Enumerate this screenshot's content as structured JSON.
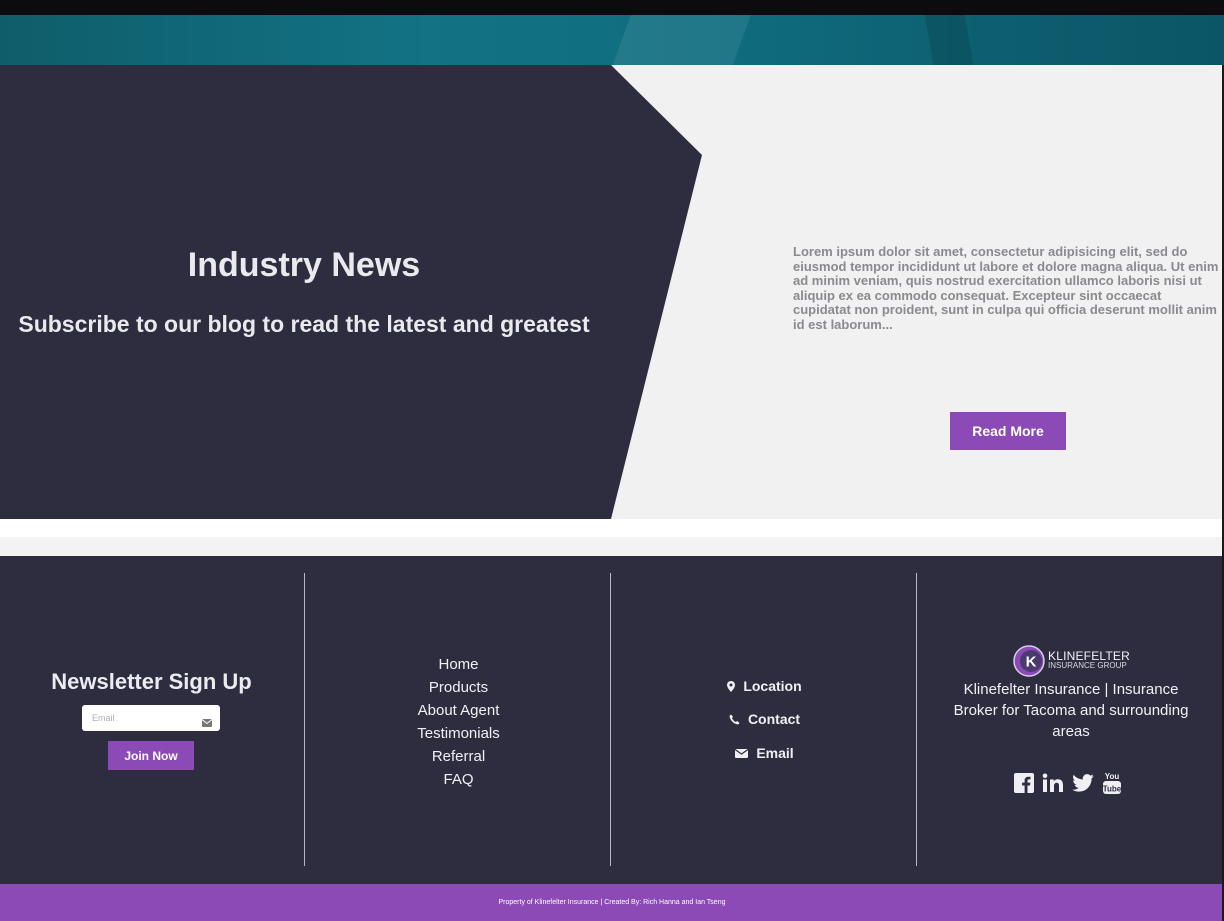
{
  "news": {
    "title": "Industry News",
    "subtitle": "Subscribe to our blog to read the latest and greatest",
    "body": "Lorem ipsum dolor sit amet, consectetur adipisicing elit, sed do eiusmod tempor incididunt ut labore et dolore magna aliqua. Ut enim ad minim veniam, quis nostrud exercitation ullamco laboris nisi ut aliquip ex ea commodo consequat. Excepteur sint occaecat cupidatat non proident, sunt in culpa qui officia deserunt mollit anim id est laborum...",
    "read_more_label": "Read More"
  },
  "newsletter": {
    "title": "Newsletter Sign Up",
    "email_placeholder": "Email",
    "join_label": "Join Now"
  },
  "nav": {
    "items": [
      "Home",
      "Products",
      "About Agent",
      "Testimonials",
      "Referral",
      "FAQ"
    ]
  },
  "contact": {
    "location_label": "Location",
    "contact_label": "Contact",
    "email_label": "Email"
  },
  "brand": {
    "logo_line1": "KLINEFELTER",
    "logo_line2": "INSURANCE GROUP",
    "logo_letter": "K",
    "description": "Klinefelter Insurance | Insurance Broker for Tacoma and surrounding areas"
  },
  "footer": {
    "copyright": "Property of Klinefelter Insurance | Created By: Rich Hanna and Ian Tseng"
  },
  "colors": {
    "dark_navy": "#2e2d40",
    "accent_purple": "#8b4ab5",
    "light_bg": "#f1f1f2",
    "teal_banner": "#127384"
  },
  "icons": {
    "location": "map-marker-icon",
    "contact": "phone-icon",
    "email": "envelope-icon",
    "socials": [
      "facebook-icon",
      "linkedin-icon",
      "twitter-icon",
      "youtube-icon"
    ]
  }
}
